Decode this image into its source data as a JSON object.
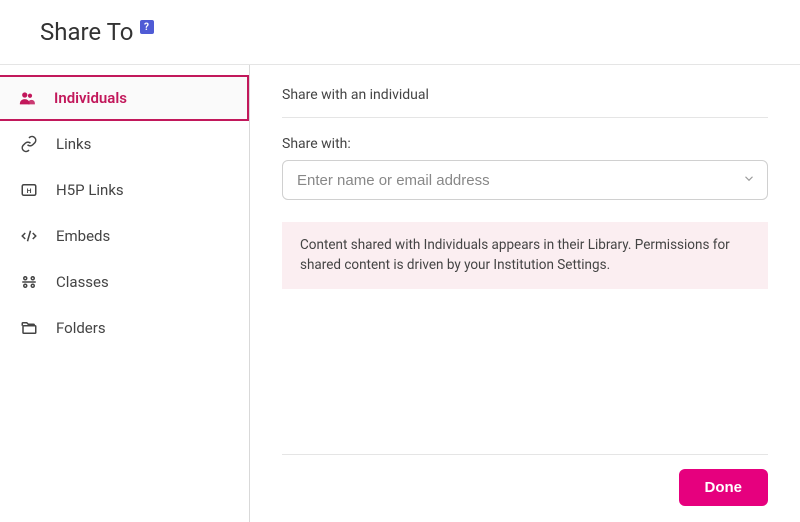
{
  "header": {
    "title": "Share To",
    "help_glyph": "?"
  },
  "sidebar": {
    "items": [
      {
        "label": "Individuals",
        "icon": "people-icon",
        "active": true
      },
      {
        "label": "Links",
        "icon": "link-icon",
        "active": false
      },
      {
        "label": "H5P Links",
        "icon": "h5p-icon",
        "active": false
      },
      {
        "label": "Embeds",
        "icon": "code-icon",
        "active": false
      },
      {
        "label": "Classes",
        "icon": "classes-icon",
        "active": false
      },
      {
        "label": "Folders",
        "icon": "folders-icon",
        "active": false
      }
    ]
  },
  "main": {
    "section_title": "Share with an individual",
    "field_label": "Share with:",
    "input_placeholder": "Enter name or email address",
    "info_text": "Content shared with Individuals appears in their Library. Permissions for shared content is driven by your Institution Settings."
  },
  "footer": {
    "done_label": "Done"
  },
  "colors": {
    "accent": "#e6007e",
    "accent_dark": "#c2185b",
    "info_bg": "#fbeef1"
  }
}
